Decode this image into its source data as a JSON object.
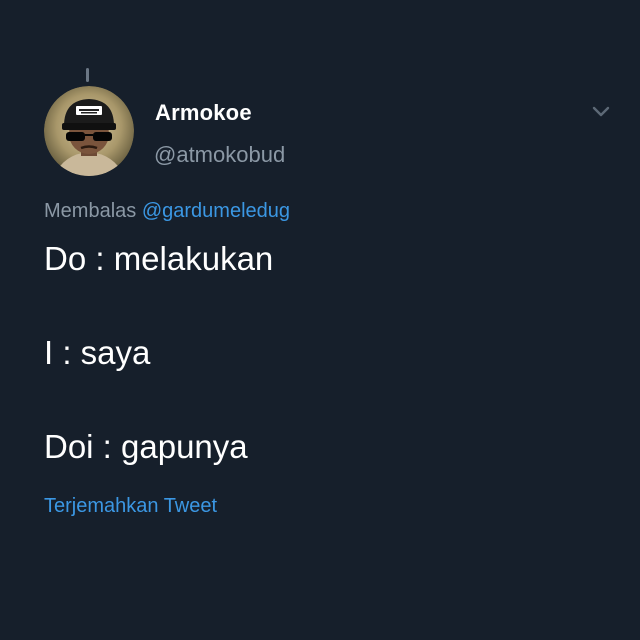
{
  "tweet": {
    "display_name": "Armokoe",
    "handle": "@atmokobud",
    "reply_prefix": "Membalas",
    "reply_to": "@gardumeledug",
    "lines": [
      "Do : melakukan",
      "I : saya",
      "Doi : gapunya"
    ],
    "translate_label": "Terjemahkan Tweet"
  },
  "icons": {
    "menu": "chevron-down-icon",
    "avatar": "profile-avatar"
  },
  "colors": {
    "background": "#161f2b",
    "name": "#ffffff",
    "secondary_text": "#8b98a5",
    "link": "#3b97e3"
  }
}
